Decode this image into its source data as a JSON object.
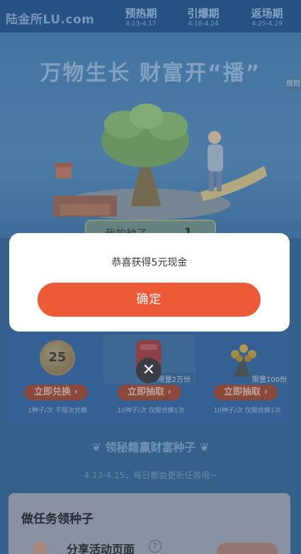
{
  "header": {
    "logo": "陆金所LU.com",
    "phases": [
      {
        "name": "预热期",
        "dates": "4.13-4.17"
      },
      {
        "name": "引爆期",
        "dates": "4.18-4.24"
      },
      {
        "name": "返场期",
        "dates": "4.25-4.29"
      }
    ]
  },
  "hero": {
    "title": "万物生长 财富开“播”",
    "rules_label": "规则",
    "seed_label": "我的种子",
    "seed_count": "1"
  },
  "prizes": [
    {
      "badge": "25",
      "button": "立即兑换 ›",
      "note": "1种子/次 不限次兑换",
      "limit": ""
    },
    {
      "badge": "",
      "button": "立即抽取 ›",
      "note": "10种子/次 仅限兑换1次",
      "limit": "限量2万份"
    },
    {
      "badge": "",
      "button": "立即抽取 ›",
      "note": "10种子/次 仅限兑换1次",
      "limit": "限量100份"
    }
  ],
  "tips": {
    "title": "领秘籍赢财富种子",
    "subtitle": "4.13-4.15，每日都会更新任务哦~"
  },
  "tasks": {
    "title": "做任务领种子",
    "items": [
      {
        "name": "分享活动页面"
      }
    ]
  },
  "modal": {
    "message": "恭喜获得5元现金",
    "confirm_label": "确定",
    "close_symbol": "✕"
  },
  "colors": {
    "confirm": "#ec5a37",
    "header_bg": "#2c5f93"
  }
}
